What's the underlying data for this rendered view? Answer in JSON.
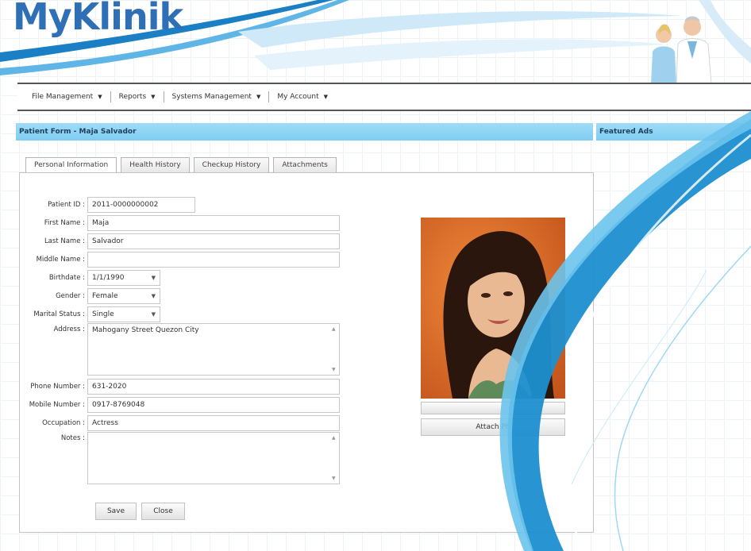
{
  "app": {
    "logo_text": "MyKlinik"
  },
  "menu": [
    {
      "label": "File Management"
    },
    {
      "label": "Reports"
    },
    {
      "label": "Systems Management"
    },
    {
      "label": "My Account"
    }
  ],
  "form_title": "Patient Form - Maja Salvador",
  "ads_title": "Featured Ads",
  "tabs": [
    {
      "label": "Personal Information"
    },
    {
      "label": "Health History"
    },
    {
      "label": "Checkup History"
    },
    {
      "label": "Attachments"
    }
  ],
  "fields": {
    "patient_id": {
      "label": "Patient ID",
      "value": "2011-0000000002"
    },
    "first_name": {
      "label": "First Name",
      "value": "Maja"
    },
    "last_name": {
      "label": "Last Name",
      "value": "Salvador"
    },
    "middle_name": {
      "label": "Middle Name",
      "value": ""
    },
    "birthdate": {
      "label": "Birthdate",
      "value": "1/1/1990"
    },
    "gender": {
      "label": "Gender",
      "value": "Female"
    },
    "marital_status": {
      "label": "Marital Status",
      "value": "Single"
    },
    "address": {
      "label": "Address",
      "value": "Mahogany Street Quezon City"
    },
    "phone_number": {
      "label": "Phone Number",
      "value": "631-2020"
    },
    "mobile_number": {
      "label": "Mobile Number",
      "value": "0917-8769048"
    },
    "occupation": {
      "label": "Occupation",
      "value": "Actress"
    },
    "notes": {
      "label": "Notes",
      "value": ""
    }
  },
  "buttons": {
    "save": "Save",
    "close": "Close",
    "attach_photo": "Attach Ph"
  },
  "colors": {
    "brand": "#2f6fb6",
    "titlebar": "#8fd4f5",
    "swoosh": "#1c8fd0"
  }
}
